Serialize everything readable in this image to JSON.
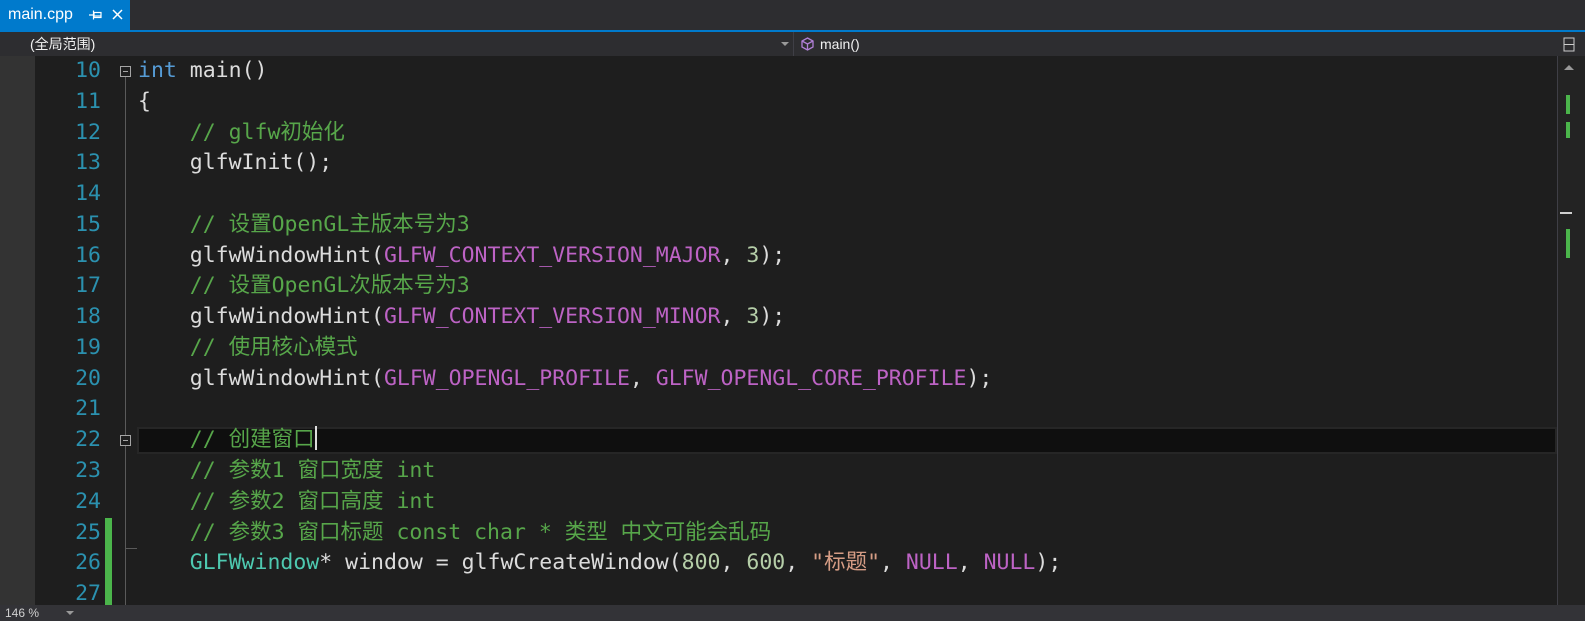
{
  "tab": {
    "label": "main.cpp",
    "active": true,
    "pin_icon": "pin-icon",
    "close_icon": "close-icon"
  },
  "navbar": {
    "scope": "(全局范围)",
    "member": "main()",
    "member_icon": "method-cube-icon",
    "split_icon": "split-window-icon"
  },
  "editor": {
    "current_line": 22,
    "lines": [
      {
        "num": 10,
        "collapsible": true,
        "tokens": [
          {
            "t": "int",
            "k": "keyword"
          },
          {
            "t": " main()",
            "k": "plain"
          }
        ]
      },
      {
        "num": 11,
        "tokens": [
          {
            "t": "{",
            "k": "plain"
          }
        ]
      },
      {
        "num": 12,
        "tokens": [
          {
            "t": "    ",
            "k": "plain"
          },
          {
            "t": "// glfw初始化",
            "k": "comment"
          }
        ]
      },
      {
        "num": 13,
        "tokens": [
          {
            "t": "    glfwInit();",
            "k": "plain"
          }
        ]
      },
      {
        "num": 14,
        "tokens": []
      },
      {
        "num": 15,
        "tokens": [
          {
            "t": "    ",
            "k": "plain"
          },
          {
            "t": "// 设置OpenGL主版本号为3",
            "k": "comment"
          }
        ]
      },
      {
        "num": 16,
        "tokens": [
          {
            "t": "    glfwWindowHint(",
            "k": "plain"
          },
          {
            "t": "GLFW_CONTEXT_VERSION_MAJOR",
            "k": "macro"
          },
          {
            "t": ", ",
            "k": "plain"
          },
          {
            "t": "3",
            "k": "number"
          },
          {
            "t": ");",
            "k": "plain"
          }
        ]
      },
      {
        "num": 17,
        "tokens": [
          {
            "t": "    ",
            "k": "plain"
          },
          {
            "t": "// 设置OpenGL次版本号为3",
            "k": "comment"
          }
        ]
      },
      {
        "num": 18,
        "tokens": [
          {
            "t": "    glfwWindowHint(",
            "k": "plain"
          },
          {
            "t": "GLFW_CONTEXT_VERSION_MINOR",
            "k": "macro"
          },
          {
            "t": ", ",
            "k": "plain"
          },
          {
            "t": "3",
            "k": "number"
          },
          {
            "t": ");",
            "k": "plain"
          }
        ]
      },
      {
        "num": 19,
        "tokens": [
          {
            "t": "    ",
            "k": "plain"
          },
          {
            "t": "// 使用核心模式",
            "k": "comment"
          }
        ]
      },
      {
        "num": 20,
        "tokens": [
          {
            "t": "    glfwWindowHint(",
            "k": "plain"
          },
          {
            "t": "GLFW_OPENGL_PROFILE",
            "k": "macro"
          },
          {
            "t": ", ",
            "k": "plain"
          },
          {
            "t": "GLFW_OPENGL_CORE_PROFILE",
            "k": "macro"
          },
          {
            "t": ");",
            "k": "plain"
          }
        ]
      },
      {
        "num": 21,
        "tokens": []
      },
      {
        "num": 22,
        "collapsible": true,
        "tokens": [
          {
            "t": "    ",
            "k": "plain"
          },
          {
            "t": "// 创建窗口",
            "k": "comment"
          }
        ]
      },
      {
        "num": 23,
        "tokens": [
          {
            "t": "    ",
            "k": "plain"
          },
          {
            "t": "// 参数1 窗口宽度 int",
            "k": "comment"
          }
        ]
      },
      {
        "num": 24,
        "tokens": [
          {
            "t": "    ",
            "k": "plain"
          },
          {
            "t": "// 参数2 窗口高度 int",
            "k": "comment"
          }
        ]
      },
      {
        "num": 25,
        "changed": true,
        "tokens": [
          {
            "t": "    ",
            "k": "plain"
          },
          {
            "t": "// 参数3 窗口标题 const char * 类型 中文可能会乱码",
            "k": "comment"
          }
        ]
      },
      {
        "num": 26,
        "changed": true,
        "tokens": [
          {
            "t": "    ",
            "k": "plain"
          },
          {
            "t": "GLFWwindow",
            "k": "type"
          },
          {
            "t": "* window = glfwCreateWindow(",
            "k": "plain"
          },
          {
            "t": "800",
            "k": "number"
          },
          {
            "t": ", ",
            "k": "plain"
          },
          {
            "t": "600",
            "k": "number"
          },
          {
            "t": ", ",
            "k": "plain"
          },
          {
            "t": "\"标题\"",
            "k": "string"
          },
          {
            "t": ", ",
            "k": "plain"
          },
          {
            "t": "NULL",
            "k": "macro"
          },
          {
            "t": ", ",
            "k": "plain"
          },
          {
            "t": "NULL",
            "k": "macro"
          },
          {
            "t": ");",
            "k": "plain"
          }
        ]
      },
      {
        "num": 27,
        "changed": true,
        "tokens": []
      }
    ]
  },
  "statusbar": {
    "zoom": "146 %"
  },
  "colors": {
    "accent": "#007ACC",
    "chrome_bg": "#2D2D30",
    "editor_bg": "#1E1E1E",
    "indicator_margin": "#333333",
    "line_number": "#2B91AF",
    "plain": "#DCDCDC",
    "keyword": "#569CD6",
    "comment": "#57A64A",
    "macro": "#BD63C5",
    "number": "#B5CEA8",
    "type": "#4EC9B0",
    "string": "#D69D85",
    "changed_line": "#4BB54B",
    "method_icon": "#B180D7",
    "current_line_bg": "#0F0F0F"
  }
}
